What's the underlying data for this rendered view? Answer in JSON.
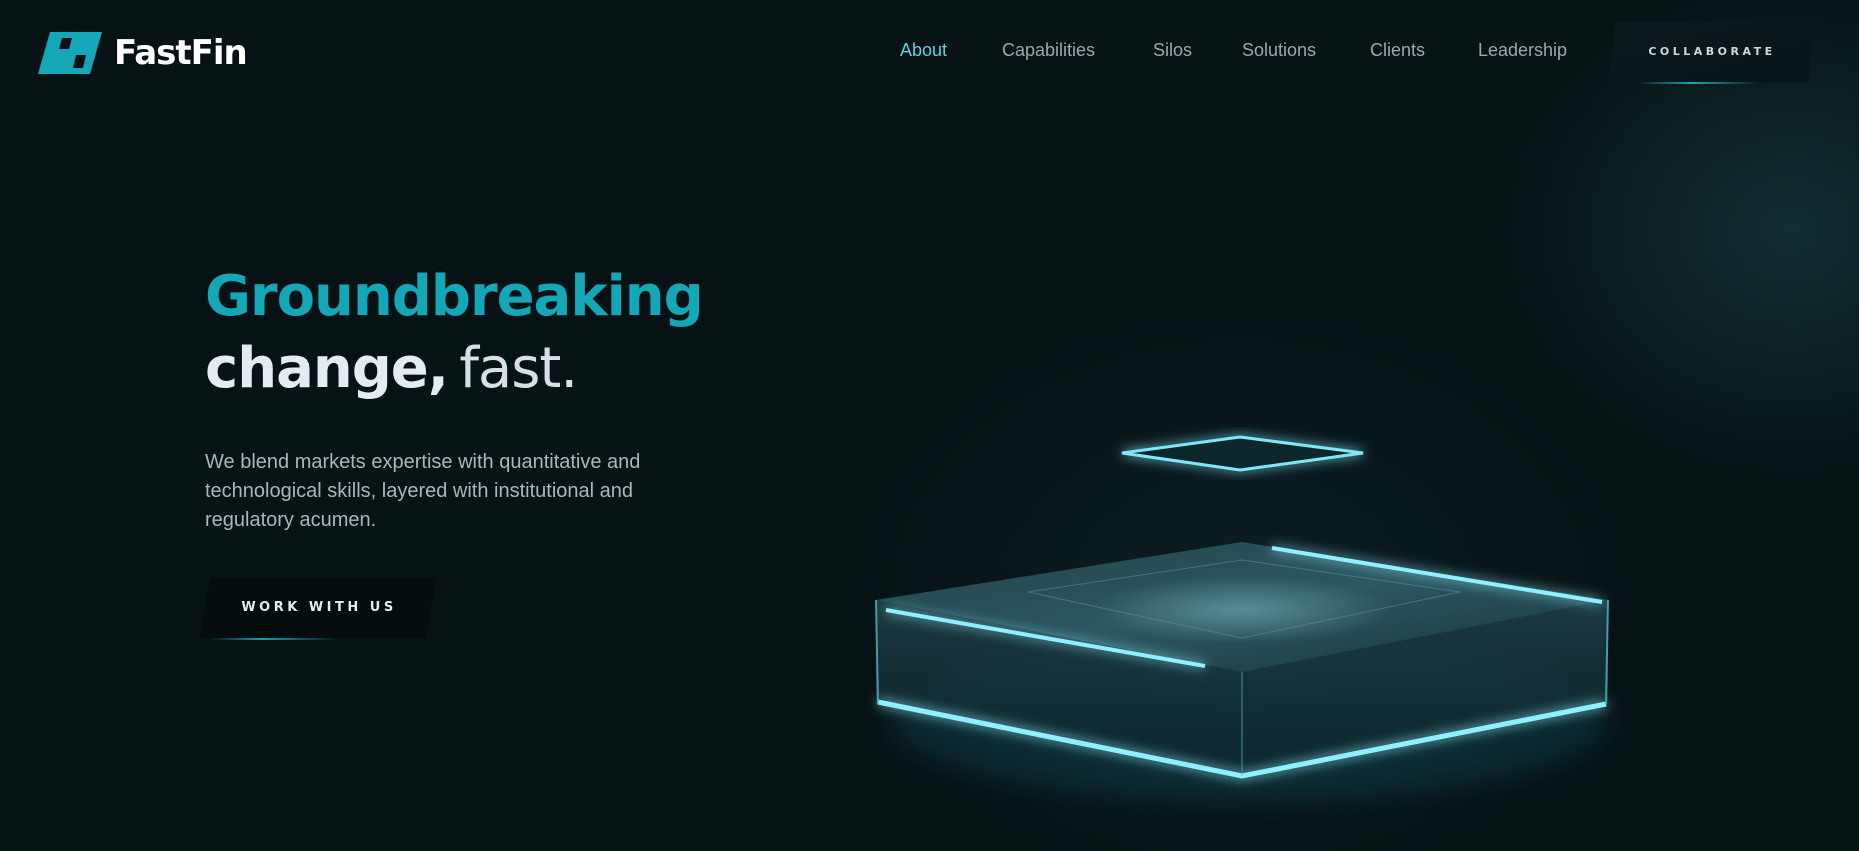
{
  "brand": {
    "name": "FastFin",
    "logo_icon": "ff-logo-mark",
    "accent_color": "#14a7b8"
  },
  "nav": {
    "items": [
      {
        "label": "About",
        "active": true
      },
      {
        "label": "Capabilities",
        "active": false
      },
      {
        "label": "Silos",
        "active": false
      },
      {
        "label": "Solutions",
        "active": false
      },
      {
        "label": "Clients",
        "active": false
      },
      {
        "label": "Leadership",
        "active": false
      }
    ],
    "cta_label": "COLLABORATE"
  },
  "hero": {
    "headline_line1": "Groundbreaking",
    "headline_bold": "change,",
    "headline_light": "fast.",
    "subtext": "We blend markets expertise with quantitative and technological skills, layered with institutional and regulatory acumen.",
    "cta_label": "WORK WITH US"
  },
  "colors": {
    "background": "#071215",
    "nav_active": "#5fd2e6",
    "glow": "#7fe8f7"
  }
}
